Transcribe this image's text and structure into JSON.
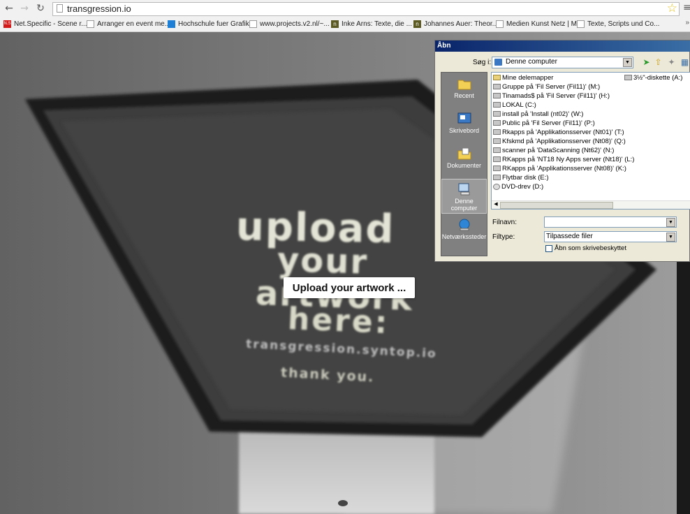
{
  "browser": {
    "url": "transgression.io",
    "bookmarks": [
      "Net.Specific - Scene r...",
      "Arranger en event me...",
      "Hochschule fuer Grafik...",
      "www.projects.v2.nl/~...",
      "Inke Arns: Texte, die ...",
      "Johannes Auer: Theor...",
      "Medien Kunst Netz | M...",
      "Texte, Scripts und Co..."
    ],
    "more": "»"
  },
  "page": {
    "screen_lines": [
      "upload",
      "your",
      "artwork",
      "here:",
      "transgression.syntop.io",
      "thank you."
    ],
    "upload_button": "Upload your artwork ..."
  },
  "dialog": {
    "title": "Åbn",
    "lookin_label": "Søg i:",
    "lookin_value": "Denne computer",
    "places": [
      "Recent",
      "Skrivebord",
      "Dokumenter",
      "Denne computer",
      "Netværkssteder"
    ],
    "files_col1": [
      "Mine delemapper",
      "Gruppe på 'Fil Server (Fil11)' (M:)",
      "Tinamads$ på 'Fil Server (Fil11)' (H:)",
      "LOKAL (C:)",
      "install på 'Install (nt02)' (W:)",
      "Public på 'Fil Server (Fil11)' (P:)",
      "Rkapps på 'Applikationsserver (Nt01)' (T:)",
      "Kfskmd på 'Applikationsserver (Nt08)' (Q:)",
      "scanner på 'DataScanning (Nt62)' (N:)",
      "RKapps på 'NT18 Ny Apps server (Nt18)' (L:)",
      "RKapps på 'Applikationsserver (Nt08)' (K:)",
      "Flytbar disk (E:)",
      "DVD-drev (D:)"
    ],
    "files_col2": [
      "3½\"-diskette (A:)"
    ],
    "filename_label": "Filnavn:",
    "filename_value": "",
    "filetype_label": "Filtype:",
    "filetype_value": "Tilpassede filer",
    "readonly_label": "Åbn som skrivebeskyttet"
  }
}
